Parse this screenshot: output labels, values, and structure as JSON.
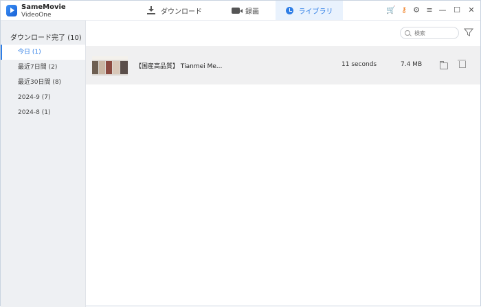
{
  "app": {
    "brand_line1": "SameMovie",
    "brand_line2": "VideoOne"
  },
  "tabs": [
    {
      "label": "ダウンロード",
      "icon": "download-icon"
    },
    {
      "label": "録画",
      "icon": "video-camera-icon"
    },
    {
      "label": "ライブラリ",
      "icon": "clock-icon",
      "active": true
    }
  ],
  "window_controls": [
    "cart-icon",
    "key-icon",
    "gear-icon",
    "menu-icon",
    "minimize-icon",
    "maximize-icon",
    "close-icon"
  ],
  "sidebar": {
    "title": "ダウンロード完了 (10)",
    "items": [
      {
        "label": "今日 (1)",
        "active": true
      },
      {
        "label": "最近7日間 (2)"
      },
      {
        "label": "最近30日間 (8)"
      },
      {
        "label": "2024-9 (7)"
      },
      {
        "label": "2024-8 (1)"
      }
    ]
  },
  "search": {
    "placeholder": "検索"
  },
  "rows": [
    {
      "title": "【国産高品質】 Tianmei Me...",
      "duration": "11 seconds",
      "size": "7.4 MB"
    }
  ],
  "colors": {
    "accent": "#2f7ee6",
    "orange": "#ef7a1a",
    "sidebar_bg": "#eef0f3",
    "row_bg": "#f0f0f1"
  }
}
